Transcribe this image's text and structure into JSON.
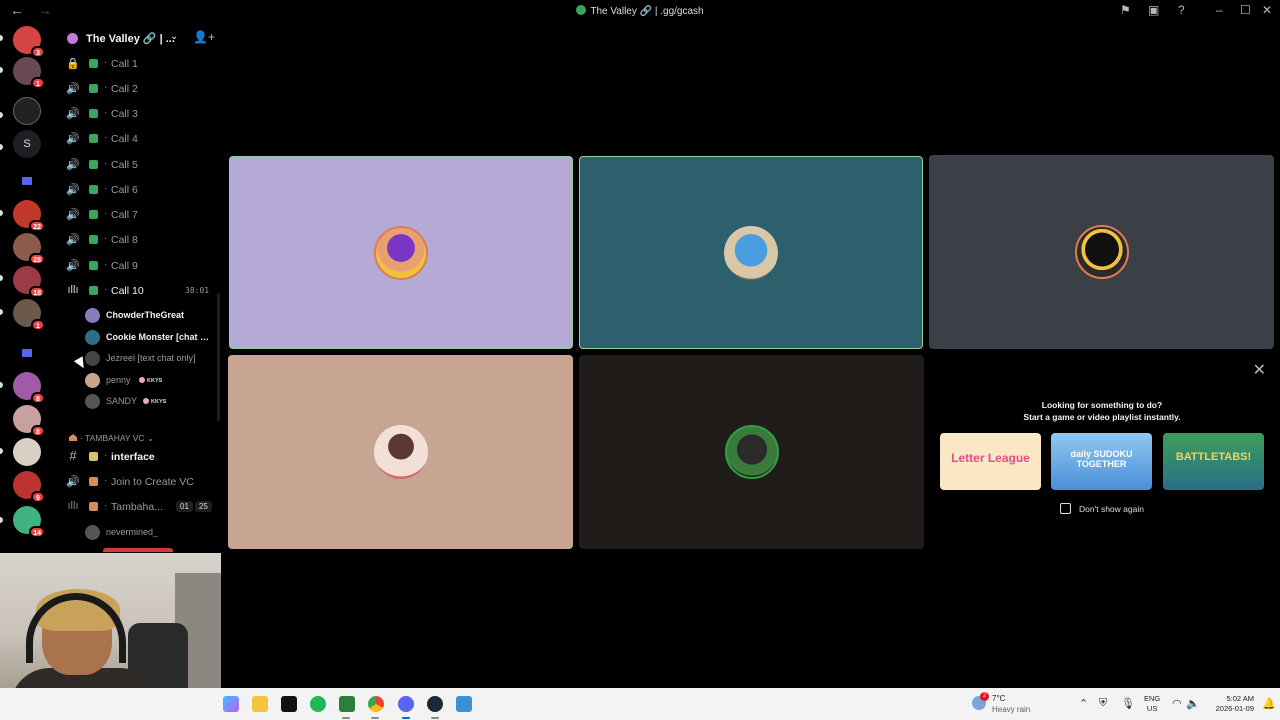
{
  "titlebar": {
    "back": "←",
    "forward": "→",
    "title": "The Valley 🔗 | .gg/gcash",
    "icons": [
      "flag-icon",
      "screen-icon",
      "help-icon"
    ],
    "win_min": "–",
    "win_max": "☐",
    "win_close": "✕"
  },
  "rail": {
    "badges": [
      "3",
      "1",
      "",
      "",
      "",
      "22",
      "28",
      "18",
      "1",
      "",
      "8",
      "8",
      "",
      "9",
      "14",
      ""
    ],
    "letter_server": "S"
  },
  "guild": {
    "name": "The Valley 🔗 | ...",
    "chevron": "⌄",
    "invite": "👤+"
  },
  "channels": [
    {
      "name": "Call 1",
      "icon": "lock-icon"
    },
    {
      "name": "Call 2",
      "icon": "speaker-icon"
    },
    {
      "name": "Call 3",
      "icon": "speaker-icon"
    },
    {
      "name": "Call 4",
      "icon": "speaker-icon"
    },
    {
      "name": "Call 5",
      "icon": "speaker-icon"
    },
    {
      "name": "Call 6",
      "icon": "speaker-icon"
    },
    {
      "name": "Call 7",
      "icon": "speaker-icon"
    },
    {
      "name": "Call 8",
      "icon": "speaker-icon"
    },
    {
      "name": "Call 9",
      "icon": "speaker-icon"
    }
  ],
  "active_channel": {
    "name": "Call 10",
    "timer": "38:01"
  },
  "voice_users": [
    {
      "name": "ChowderTheGreat",
      "bright": true,
      "color": "#8a7bbd"
    },
    {
      "name": "Cookie Monster [chat o...",
      "bright": true,
      "color": "#2f6d8a"
    },
    {
      "name": "Jezreel [text chat only]",
      "bright": false,
      "color": "#444"
    },
    {
      "name": "penny",
      "bright": false,
      "color": "#c9a58a",
      "tag": "KKYS"
    },
    {
      "name": "SANDY",
      "bright": false,
      "color": "#555",
      "tag": "KKYS"
    }
  ],
  "category": {
    "name": "TAMBAHAY VC",
    "chevron": "⌄"
  },
  "extra_channels": [
    {
      "name": "interface",
      "icon": "hash-icon"
    },
    {
      "name": "Join to Create VC",
      "icon": "speaker-icon"
    }
  ],
  "tambahay": {
    "name": "Tambaha...",
    "badge1": "01",
    "badge2": "25"
  },
  "tambahay_user": "nevermined_",
  "activity": {
    "close": "✕",
    "line1": "Looking for something to do?",
    "line2": "Start a game or video playlist instantly.",
    "games": [
      "Letter League",
      "daily SUDOKU TOGETHER",
      "BATTLETABS!"
    ],
    "dont_show": "Don't show again"
  },
  "weather": {
    "badge": "2",
    "temp": "7°C",
    "cond": "Heavy rain"
  },
  "lang": {
    "l1": "ENG",
    "l2": "US"
  },
  "clock": {
    "time": "5:02 AM",
    "date": "2026-01-09"
  },
  "colors": {
    "tile1": "#b5a9d6",
    "tile2": "#2e5f6d",
    "tile3": "#3b3f47",
    "tile4": "#c8a592",
    "tile5": "#1f1c19",
    "speaking_border": "#8fd19e",
    "accent": "#5865f2"
  }
}
